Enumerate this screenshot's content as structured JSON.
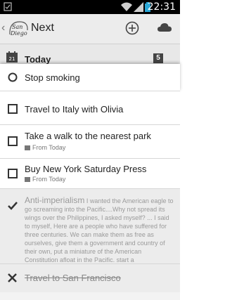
{
  "status": {
    "time": "22:31"
  },
  "actionbar": {
    "title": "Next",
    "logo_text": "San Diego"
  },
  "section": {
    "label": "Today",
    "count": "5",
    "calendar_day": "21"
  },
  "tasks": [
    {
      "title": "Stop smoking",
      "state": "open-circle"
    },
    {
      "title": "Travel to Italy with Olivia",
      "state": "open"
    },
    {
      "title": "Take a walk to the nearest park",
      "sub": "From Today",
      "state": "open"
    },
    {
      "title": "Buy New York Saturday Press",
      "sub": "From Today",
      "state": "open"
    },
    {
      "title": "Anti-imperialism",
      "note": "I wanted the American eagle to go screaming into the Pacific....Why not spread its wings over the Philippines, I asked myself? ... I said to myself, Here are a people who have suffered for three centuries. We can make them as free as ourselves, give them a government and country of their own, put a miniature of the American Constitution afloat in the Pacific, start a",
      "state": "done"
    },
    {
      "title": "Travel to San Francisco",
      "state": "cancelled"
    }
  ],
  "colors": {
    "accent": "#222222",
    "done_bg": "#ececec",
    "muted": "#9a9a9a"
  }
}
